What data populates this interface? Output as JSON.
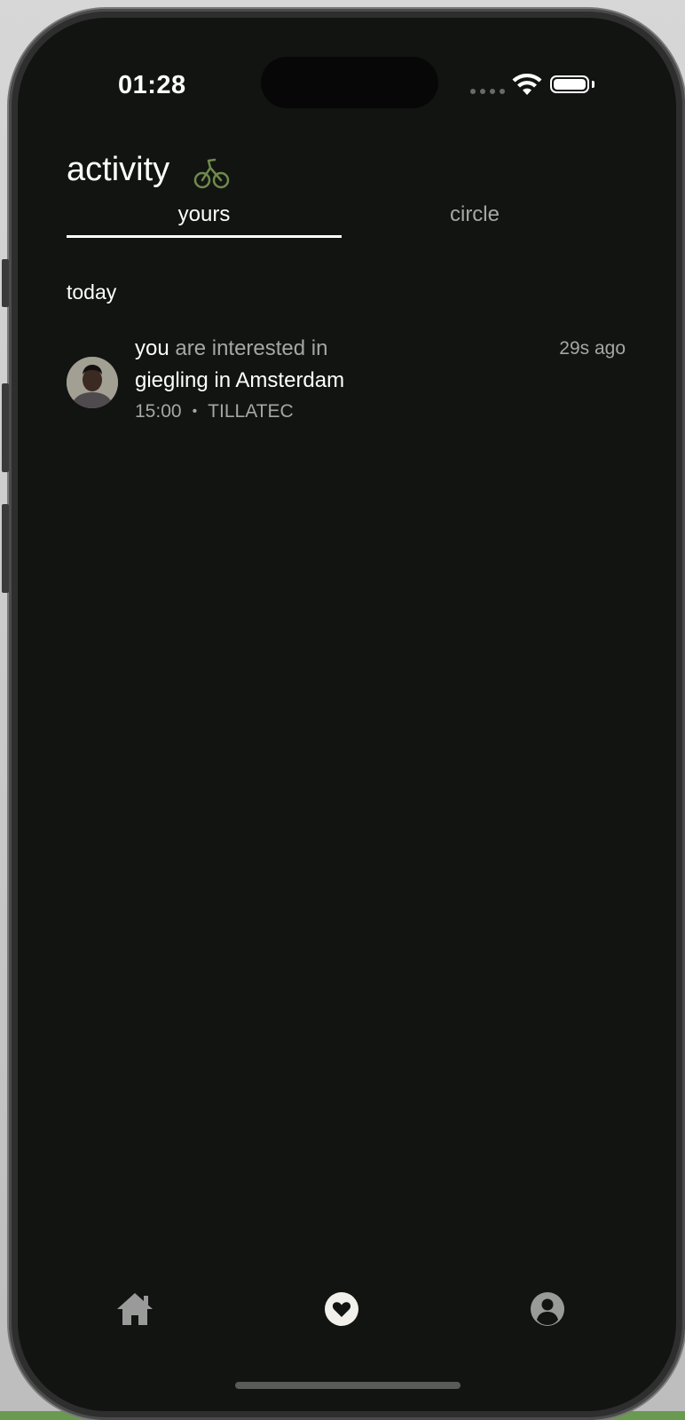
{
  "status_bar": {
    "time": "01:28"
  },
  "header": {
    "title": "activity",
    "icon": "bicycle-icon",
    "accent_color": "#6f8a4c"
  },
  "tabs": [
    {
      "label": "yours",
      "active": true
    },
    {
      "label": "circle",
      "active": false
    }
  ],
  "sections": [
    {
      "label": "today",
      "items": [
        {
          "actor": "you",
          "verb": "are interested in",
          "event": "giegling in Amsterdam",
          "time": "15:00",
          "separator": "•",
          "venue": "TILLATEC",
          "time_ago": "29s ago"
        }
      ]
    }
  ],
  "bottom_nav": [
    {
      "icon": "home-icon",
      "active": false
    },
    {
      "icon": "heart-icon",
      "active": true
    },
    {
      "icon": "profile-icon",
      "active": false
    }
  ]
}
